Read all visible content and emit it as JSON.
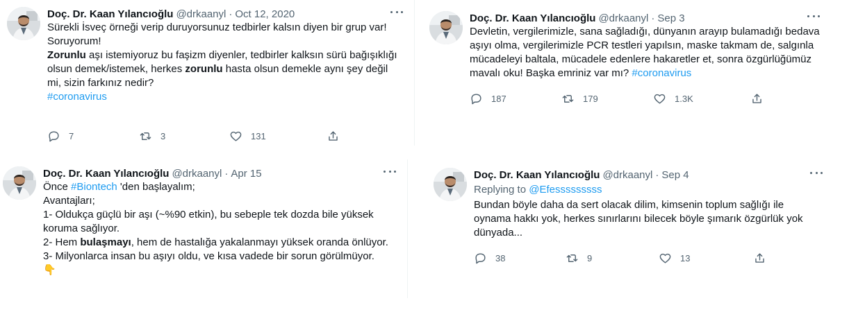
{
  "tweets": [
    {
      "name": "Doç. Dr. Kaan Yılancıoğlu",
      "handle": "@drkaanyl",
      "date": "Oct 12, 2020",
      "lines": [
        "Sürekli İsveç örneği verip duruyorsunuz tedbirler kalsın diyen bir grup var!",
        "Soruyorum!"
      ],
      "p3_bold_1": "Zorunlu",
      "p3_text_1": " aşı istemiyoruz bu faşizm diyenler, tedbirler kalksın sürü bağışıklığı olsun demek/istemek, herkes ",
      "p3_bold_2": "zorunlu",
      "p3_text_2": " hasta olsun demekle aynı şey değil mi, sizin farkınız nedir?",
      "hashtag": "#coronavirus",
      "replies": "7",
      "retweets": "3",
      "likes": "131"
    },
    {
      "name": "Doç. Dr. Kaan Yılancıoğlu",
      "handle": "@drkaanyl",
      "date": "Sep 3",
      "text": "Devletin, vergilerimizle, sana sağladığı, dünyanın arayıp bulamadığı bedava aşıyı olma, vergilerimizle PCR testleri yapılsın, maske takmam de, salgınla mücadeleyi baltala, mücadele edenlere hakaretler et, sonra özgürlüğümüz mavalı oku! Başka emriniz var mı? ",
      "hashtag": "#coronavirus",
      "replies": "187",
      "retweets": "179",
      "likes": "1.3K"
    },
    {
      "name": "Doç. Dr. Kaan Yılancıoğlu",
      "handle": "@drkaanyl",
      "date": "Apr 15",
      "line1_pre": "Önce ",
      "line1_tag": "#Biontech",
      "line1_post": " 'den başlayalım;",
      "line2": "Avantajları;",
      "line3": "1- Oldukça güçlü bir aşı (~%90 etkin), bu sebeple tek dozda bile yüksek koruma sağlıyor.",
      "line4_pre": "2- Hem ",
      "line4_bold": "bulaşmayı",
      "line4_post": ", hem de hastalığa yakalanmayı yüksek oranda önlüyor.",
      "line5": "3- Milyonlarca insan bu aşıyı oldu, ve kısa vadede bir sorun görülmüyor.",
      "emoji": "👇"
    },
    {
      "name": "Doç. Dr. Kaan Yılancıoğlu",
      "handle": "@drkaanyl",
      "date": "Sep 4",
      "replying_label": "Replying to ",
      "replying_handle": "@Efesssssssss",
      "text": "Bundan böyle daha da sert olacak dilim, kimsenin toplum sağlığı ile oynama hakkı yok, herkes sınırlarını bilecek böyle şımarık özgürlük yok dünyada...",
      "replies": "38",
      "retweets": "9",
      "likes": "13"
    }
  ],
  "separator": "·",
  "icons": [
    "avatar",
    "more-icon",
    "reply-icon",
    "retweet-icon",
    "like-icon",
    "share-icon"
  ]
}
